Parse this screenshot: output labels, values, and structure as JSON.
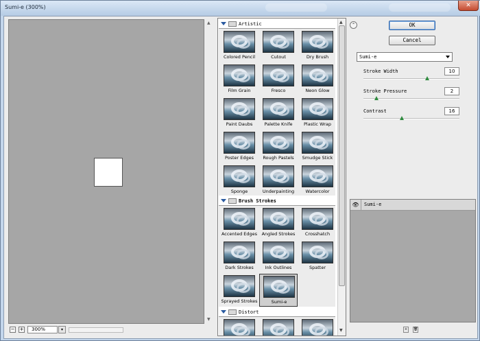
{
  "window": {
    "title": "Sumi-e (300%)",
    "close_label": "✕"
  },
  "preview": {
    "zoom_value": "300%",
    "zoom_out": "−",
    "zoom_in": "+",
    "zoom_dropdown": "▾"
  },
  "gallery": {
    "categories": [
      {
        "name": "Artistic",
        "filters": [
          "Colored Pencil",
          "Cutout",
          "Dry Brush",
          "Film Grain",
          "Fresco",
          "Neon Glow",
          "Paint Daubs",
          "Palette Knife",
          "Plastic Wrap",
          "Poster Edges",
          "Rough Pastels",
          "Smudge Stick",
          "Sponge",
          "Underpainting",
          "Watercolor"
        ]
      },
      {
        "name": "Brush Strokes",
        "filters": [
          "Accented Edges",
          "Angled Strokes",
          "Crosshatch",
          "Dark Strokes",
          "Ink Outlines",
          "Spatter",
          "Sprayed Strokes",
          "Sumi-e"
        ]
      },
      {
        "name": "Distort",
        "filters": []
      }
    ],
    "selected_filter": "Sumi-e"
  },
  "buttons": {
    "ok": "OK",
    "cancel": "Cancel",
    "collapse": "⌃"
  },
  "settings": {
    "filter_dropdown": "Sumi-e",
    "params": [
      {
        "label": "Stroke Width",
        "value": "10",
        "min": 0,
        "max": 15
      },
      {
        "label": "Stroke Pressure",
        "value": "2",
        "min": 0,
        "max": 15
      },
      {
        "label": "Contrast",
        "value": "16",
        "min": 0,
        "max": 40
      }
    ]
  },
  "layers": {
    "items": [
      {
        "name": "Sumi-e",
        "visible": true
      }
    ],
    "new_icon": "+",
    "delete_icon": "🗑"
  }
}
